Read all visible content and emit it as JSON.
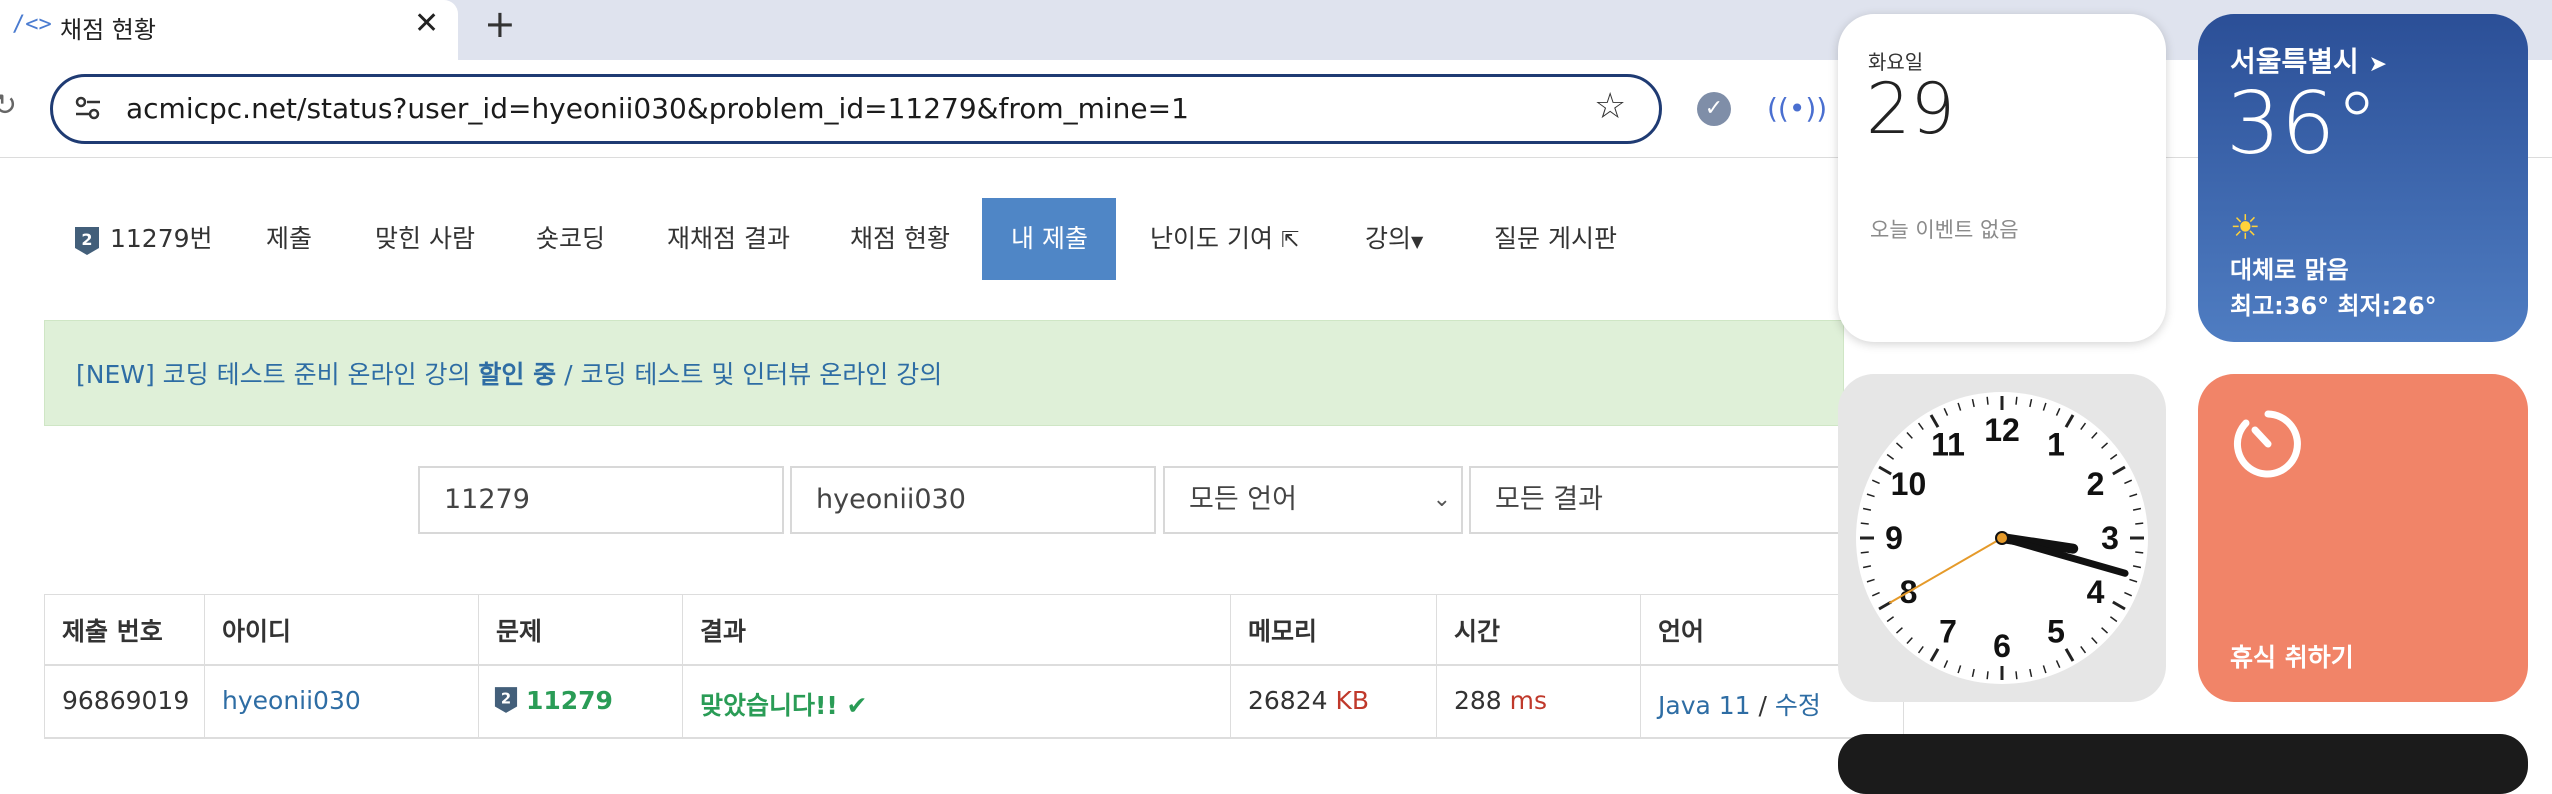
{
  "browser": {
    "tab_title": "채점 현황",
    "tab_icon": "code-brackets-icon",
    "new_tab": "+",
    "close": "✕",
    "url": "acmicpc.net/status?user_id=hyeonii030&problem_id=11279&from_mine=1"
  },
  "nav": {
    "problem": "11279번",
    "items": [
      "제출",
      "맞힌 사람",
      "숏코딩",
      "재채점 결과",
      "채점 현황",
      "내 제출",
      "난이도 기여",
      "강의",
      "질문 게시판"
    ],
    "active_index": 5
  },
  "notice": {
    "prefix": "[NEW] 코딩 테스트 준비 온라인 강의 ",
    "bold": "할인 중",
    "separator": " / ",
    "suffix": "코딩 테스트 및 인터뷰 온라인 강의"
  },
  "filters": {
    "problem_id": "11279",
    "user_id": "hyeonii030",
    "language": "모든 언어",
    "result": "모든 결과"
  },
  "table": {
    "headers": [
      "제출 번호",
      "아이디",
      "문제",
      "결과",
      "메모리",
      "시간",
      "언어"
    ],
    "rows": [
      {
        "submission_id": "96869019",
        "user": "hyeonii030",
        "problem": "11279",
        "result": "맞았습니다!!",
        "memory": "26824",
        "memory_unit": "KB",
        "time": "288",
        "time_unit": "ms",
        "language": "Java 11",
        "lang_sep": " / ",
        "edit": "수정"
      }
    ]
  },
  "widgets": {
    "calendar": {
      "weekday": "화요일",
      "date": "29",
      "events": "오늘 이벤트 없음"
    },
    "weather": {
      "city": "서울특별시",
      "temp": "36°",
      "condition": "대체로 맑음",
      "hilo": "최고:36° 최저:26°"
    },
    "clock": {
      "numbers": [
        "12",
        "1",
        "2",
        "3",
        "4",
        "5",
        "6",
        "7",
        "8",
        "9",
        "10",
        "11"
      ],
      "hour": 3,
      "minute": 17,
      "second": 40
    },
    "timer": {
      "label": "휴식 취하기"
    }
  },
  "colors": {
    "nav_active": "#4f86c6",
    "link": "#2e6da4",
    "accepted": "#2a9c56",
    "unit": "#c0392b"
  }
}
